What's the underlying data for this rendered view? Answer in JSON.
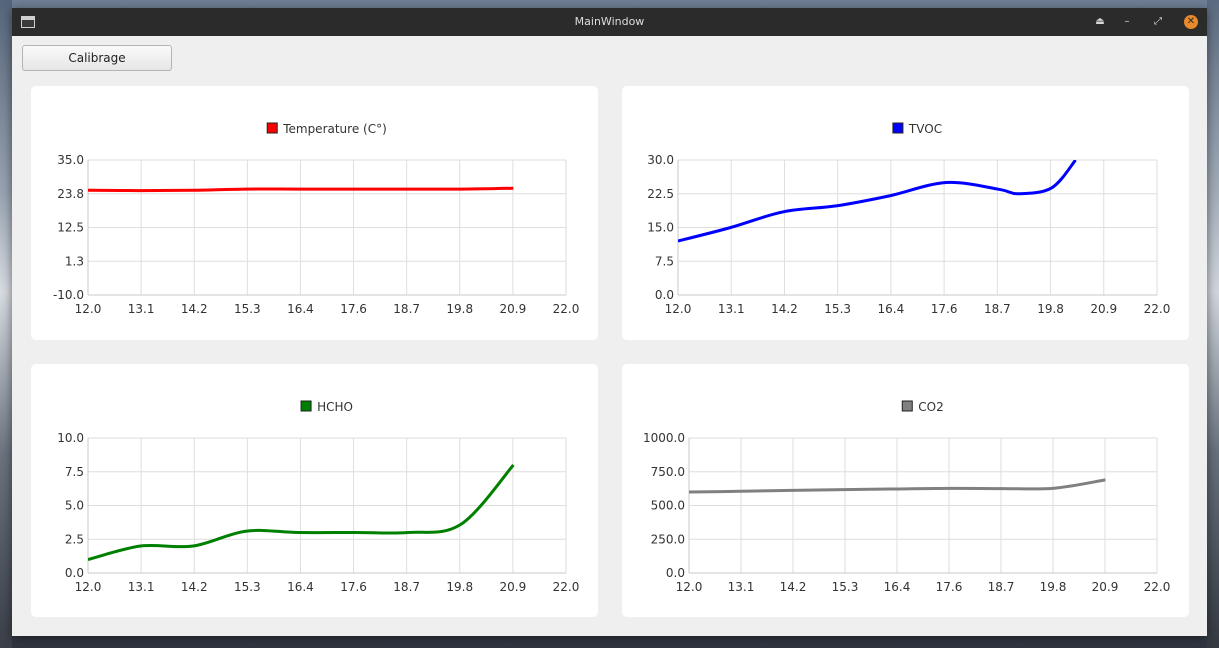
{
  "window": {
    "title": "MainWindow",
    "controls": {
      "minimize": "–",
      "maximize": "⤢",
      "eject": "⏏",
      "close": "✕"
    }
  },
  "toolbar": {
    "calibrate_label": "Calibrage"
  },
  "chart_data": [
    {
      "type": "line",
      "title": "",
      "legend": "top-center",
      "series": [
        {
          "name": "Temperature (C°)",
          "color": "#ff0000",
          "x": [
            12.0,
            13.1,
            14.2,
            15.3,
            16.4,
            17.6,
            18.7,
            19.8,
            20.9
          ],
          "y": [
            24.9,
            24.8,
            24.9,
            25.3,
            25.3,
            25.3,
            25.3,
            25.3,
            25.6
          ]
        }
      ],
      "xlim": [
        12.0,
        22.0
      ],
      "ylim": [
        -10.0,
        35.0
      ],
      "xticks": [
        "12.0",
        "13.1",
        "14.2",
        "15.3",
        "16.4",
        "17.6",
        "18.7",
        "19.8",
        "20.9",
        "22.0"
      ],
      "yticks": [
        "35.0",
        "23.8",
        "12.5",
        "1.3",
        "-10.0"
      ],
      "grid": true
    },
    {
      "type": "line",
      "title": "",
      "legend": "top-center",
      "series": [
        {
          "name": "TVOC",
          "color": "#0000ff",
          "x": [
            12.0,
            13.1,
            14.2,
            15.3,
            16.4,
            17.6,
            18.7,
            19.1,
            19.8,
            20.3
          ],
          "y": [
            12.0,
            15.0,
            18.5,
            19.8,
            22.0,
            25.0,
            23.5,
            22.5,
            23.8,
            30.0
          ]
        }
      ],
      "xlim": [
        12.0,
        22.0
      ],
      "ylim": [
        0.0,
        30.0
      ],
      "xticks": [
        "12.0",
        "13.1",
        "14.2",
        "15.3",
        "16.4",
        "17.6",
        "18.7",
        "19.8",
        "20.9",
        "22.0"
      ],
      "yticks": [
        "30.0",
        "22.5",
        "15.0",
        "7.5",
        "0.0"
      ],
      "grid": true
    },
    {
      "type": "line",
      "title": "",
      "legend": "top-center",
      "series": [
        {
          "name": "HCHO",
          "color": "#008000",
          "x": [
            12.0,
            13.1,
            14.2,
            15.3,
            16.4,
            17.6,
            18.7,
            19.8,
            20.9
          ],
          "y": [
            1.0,
            2.0,
            2.0,
            3.1,
            3.0,
            3.0,
            3.0,
            3.6,
            8.0
          ]
        }
      ],
      "xlim": [
        12.0,
        22.0
      ],
      "ylim": [
        0.0,
        10.0
      ],
      "xticks": [
        "12.0",
        "13.1",
        "14.2",
        "15.3",
        "16.4",
        "17.6",
        "18.7",
        "19.8",
        "20.9",
        "22.0"
      ],
      "yticks": [
        "10.0",
        "7.5",
        "5.0",
        "2.5",
        "0.0"
      ],
      "grid": true
    },
    {
      "type": "line",
      "title": "",
      "legend": "top-center",
      "series": [
        {
          "name": "CO2",
          "color": "#808080",
          "x": [
            12.0,
            13.1,
            14.2,
            15.3,
            16.4,
            17.6,
            18.7,
            19.8,
            20.9
          ],
          "y": [
            600,
            605,
            612,
            618,
            622,
            627,
            625,
            628,
            690
          ]
        }
      ],
      "xlim": [
        12.0,
        22.0
      ],
      "ylim": [
        0.0,
        1000.0
      ],
      "xticks": [
        "12.0",
        "13.1",
        "14.2",
        "15.3",
        "16.4",
        "17.6",
        "18.7",
        "19.8",
        "20.9",
        "22.0"
      ],
      "yticks": [
        "1000.0",
        "750.0",
        "500.0",
        "250.0",
        "0.0"
      ],
      "grid": true
    }
  ]
}
